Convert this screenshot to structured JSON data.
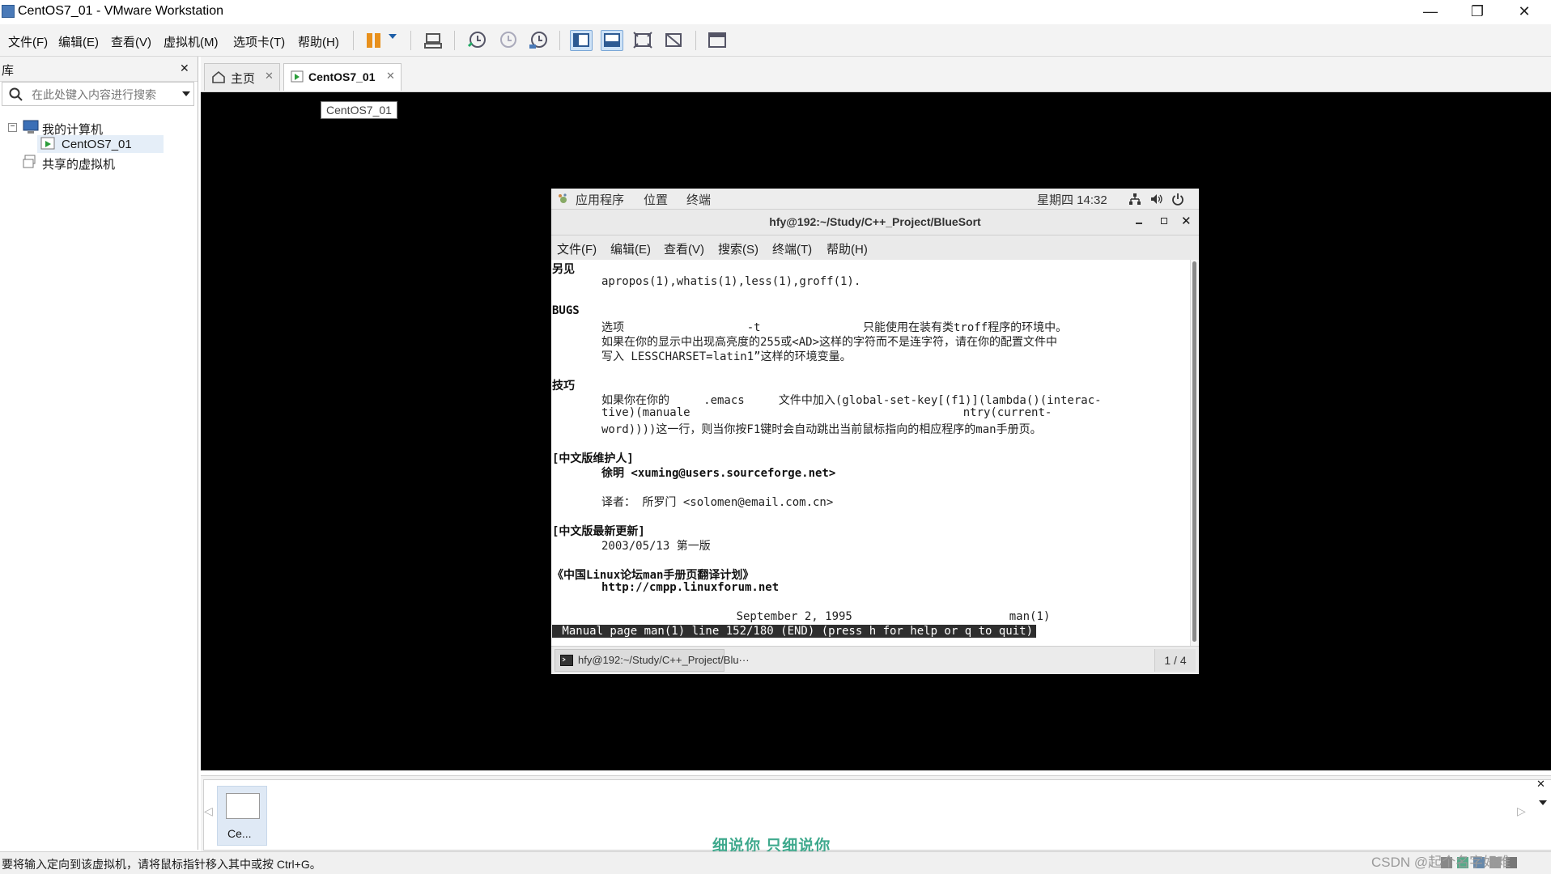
{
  "window": {
    "title": "CentOS7_01 - VMware Workstation",
    "minimize": "—",
    "restore": "❐",
    "close": "✕"
  },
  "menu": [
    "文件(F)",
    "编辑(E)",
    "查看(V)",
    "虚拟机(M)",
    "选项卡(T)",
    "帮助(H)"
  ],
  "toolbar": {
    "pause_color": "#e8901c",
    "icons": [
      "pause-icon",
      "dropdown-icon",
      "send-keys-icon",
      "snapshot-icon",
      "revert-snapshot-icon",
      "snapshot-manager-icon",
      "view-library-icon",
      "view-thumbnail-icon",
      "fullscreen-icon",
      "unity-icon",
      "console-view-icon"
    ]
  },
  "library": {
    "header": "库",
    "close": "✕",
    "search_placeholder": "在此处键入内容进行搜索",
    "tree": {
      "my_computer": "我的计算机",
      "vm": "CentOS7_01",
      "shared": "共享的虚拟机"
    }
  },
  "tabs": [
    {
      "label": "主页",
      "close": "✕"
    },
    {
      "label": "CentOS7_01",
      "close": "✕"
    }
  ],
  "tooltip": "CentOS7_01",
  "guest": {
    "topbar": {
      "apps": "应用程序",
      "places": "位置",
      "terminal": "终端",
      "clock": "星期四 14:32"
    },
    "terminal_title": "hfy@192:~/Study/C++_Project/BlueSort",
    "terminal_menu": [
      "文件(F)",
      "编辑(E)",
      "查看(V)",
      "搜索(S)",
      "终端(T)",
      "帮助(H)"
    ],
    "lines": [
      {
        "text": "另见",
        "bold": true,
        "indent": 0
      },
      {
        "text": "apropos(1),whatis(1),less(1),groff(1).",
        "bold": false,
        "indent": 1
      },
      {
        "text": "",
        "bold": false,
        "indent": 0
      },
      {
        "text": "BUGS",
        "bold": true,
        "indent": 0
      },
      {
        "text": "选项                  -t               只能使用在装有类troff程序的环境中。",
        "bold": false,
        "indent": 1
      },
      {
        "text": "如果在你的显示中出现高亮度的255或<AD>这样的字符而不是连字符，请在你的配置文件中",
        "bold": false,
        "indent": 1
      },
      {
        "text": "写入 LESSCHARSET=latin1”这样的环境变量。",
        "bold": false,
        "indent": 1
      },
      {
        "text": "",
        "bold": false,
        "indent": 0
      },
      {
        "text": "技巧",
        "bold": true,
        "indent": 0
      },
      {
        "text": "如果你在你的     .emacs     文件中加入(global-set-key[(f1)](lambda()(interac-",
        "bold": false,
        "indent": 1
      },
      {
        "text": "tive)(manuale                                        ntry(current-",
        "bold": false,
        "indent": 1
      },
      {
        "text": "word))))这一行，则当你按F1键时会自动跳出当前鼠标指向的相应程序的man手册页。",
        "bold": false,
        "indent": 1
      },
      {
        "text": "",
        "bold": false,
        "indent": 0
      },
      {
        "text": "[中文版维护人]",
        "bold": true,
        "indent": 0
      },
      {
        "text": "徐明 <xuming@users.sourceforge.net>",
        "bold": true,
        "indent": 1
      },
      {
        "text": "",
        "bold": false,
        "indent": 0
      },
      {
        "text": "译者： 所罗门 <solomen@email.com.cn>",
        "bold": false,
        "indent": 1
      },
      {
        "text": "",
        "bold": false,
        "indent": 0
      },
      {
        "text": "[中文版最新更新]",
        "bold": true,
        "indent": 0
      },
      {
        "text": "2003/05/13 第一版",
        "bold": false,
        "indent": 1
      },
      {
        "text": "",
        "bold": false,
        "indent": 0
      },
      {
        "text": "《中国Linux论坛man手册页翻译计划》",
        "bold": true,
        "indent": 0
      },
      {
        "text": "http://cmpp.linuxforum.net",
        "bold": true,
        "indent": 1
      },
      {
        "text": "",
        "bold": false,
        "indent": 0
      },
      {
        "text": "                           September 2, 1995                       man(1)",
        "bold": false,
        "indent": 0
      }
    ],
    "pager_status": " Manual page man(1) line 152/180 (END) (press h for help or q to quit)",
    "taskbar_item": "hfy@192:~/Study/C++_Project/Blu···",
    "workspace": "1 / 4"
  },
  "thumbnail": {
    "label": "Ce..."
  },
  "status_text": "要将输入定向到该虚拟机，请将鼠标指针移入其中或按 Ctrl+G。",
  "overlay_text": "细说你 只细说你",
  "watermark": "CSDN @起个名字好难"
}
